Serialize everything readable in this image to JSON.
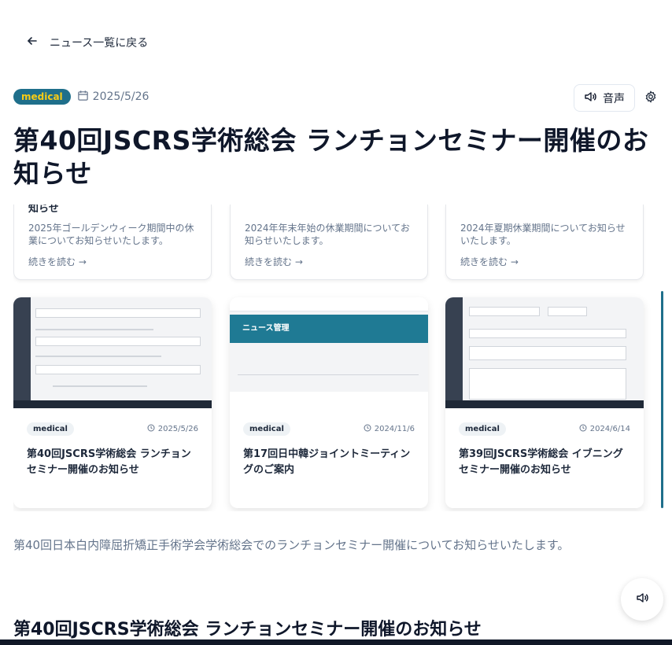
{
  "back_link": {
    "label": "ニュース一覧に戻る"
  },
  "article": {
    "category": "medical",
    "date": "2025/5/26",
    "title": "第40回JSCRS学術総会 ランチョンセミナー開催のお知らせ",
    "intro": "第40回日本白内障屈折矯正手術学会学術総会でのランチョンセミナー開催についてお知らせいたします。",
    "section_heading": "第40回JSCRS学術総会 ランチョンセミナー開催のお知らせ"
  },
  "toolbar": {
    "audio_label": "音声"
  },
  "top_cards": [
    {
      "cut_title": "知らせ",
      "excerpt": "2025年ゴールデンウィーク期間中の休業についてお知らせいたします。",
      "more": "続きを読む →"
    },
    {
      "cut_title": "",
      "excerpt": "2024年年末年始の休業期間についてお知らせいたします。",
      "more": "続きを読む →"
    },
    {
      "cut_title": "",
      "excerpt": "2024年夏期休業期間についてお知らせいたします。",
      "more": "続きを読む →"
    }
  ],
  "news_cards": [
    {
      "category": "medical",
      "date": "2025/5/26",
      "title": "第40回JSCRS学術総会 ランチョンセミナー開催のお知らせ"
    },
    {
      "category": "medical",
      "date": "2024/11/6",
      "title": "第17回日中韓ジョイントミーティングのご案内",
      "thumb_heading": "ニュース管理"
    },
    {
      "category": "medical",
      "date": "2024/6/14",
      "title": "第39回JSCRS学術総会 イブニングセミナー開催のお知らせ"
    }
  ],
  "icons": {
    "back": "arrow-left-icon",
    "calendar": "calendar-icon",
    "speaker": "speaker-icon",
    "settings": "gear-icon",
    "clock": "clock-icon"
  },
  "colors": {
    "badge_bg": "#1f6f8b",
    "badge_text": "#facc15",
    "title": "#0f172a",
    "muted": "#64748b"
  }
}
